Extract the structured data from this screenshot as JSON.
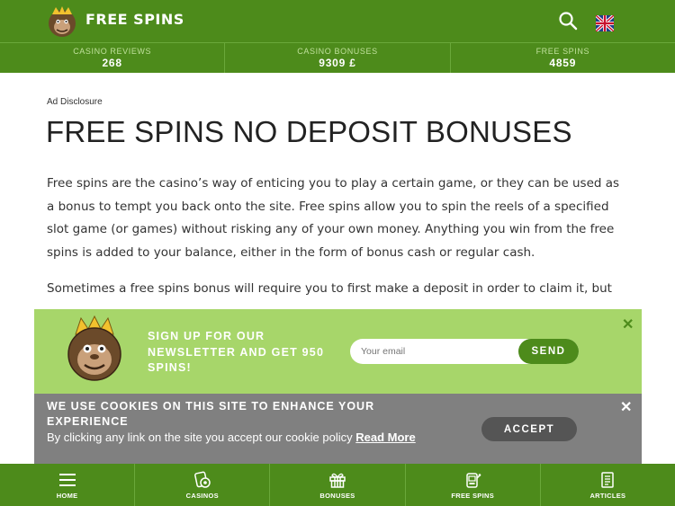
{
  "header": {
    "brand": "FREE SPINS",
    "logo_icon": "gorilla-king-logo",
    "search_icon": "search-icon",
    "flag_icon": "uk-flag-icon"
  },
  "stats": [
    {
      "label": "CASINO REVIEWS",
      "value": "268"
    },
    {
      "label": "CASINO BONUSES",
      "value": "9309 £"
    },
    {
      "label": "FREE SPINS",
      "value": "4859"
    }
  ],
  "content": {
    "ad_disclosure": "Ad Disclosure",
    "title": "FREE SPINS NO DEPOSIT BONUSES",
    "paragraph1": "Free spins are the casino’s way of enticing you to play a certain game, or they can be used as a bonus to tempt you back onto the site. Free spins allow you to spin the reels of a specified slot game (or games) without risking any of your own money. Anything you win from the free spins is added to your balance, either in the form of bonus cash or regular cash.",
    "paragraph2": "Sometimes a free spins bonus will require you to first make a deposit in order to claim it, but"
  },
  "newsletter": {
    "text": "SIGN UP FOR OUR NEWSLETTER AND GET 950 SPINS!",
    "placeholder": "Your email",
    "send_label": "SEND",
    "close_label": "✕"
  },
  "cookie": {
    "title": "WE USE COOKIES ON THIS SITE TO ENHANCE YOUR EXPERIENCE",
    "body": "By clicking any link on the site you accept our cookie policy",
    "link": "Read More",
    "accept_label": "ACCEPT",
    "close_label": "✕"
  },
  "bottom_nav": [
    {
      "label": "HOME",
      "icon": "menu-icon"
    },
    {
      "label": "CASINOS",
      "icon": "casino-chip-icon"
    },
    {
      "label": "BONUSES",
      "icon": "gift-icon"
    },
    {
      "label": "FREE SPINS",
      "icon": "slot-machine-icon"
    },
    {
      "label": "ARTICLES",
      "icon": "article-icon"
    }
  ],
  "colors": {
    "brand_green": "#4d8b1b",
    "light_green": "#a7d66a",
    "cookie_gray": "#808080"
  }
}
